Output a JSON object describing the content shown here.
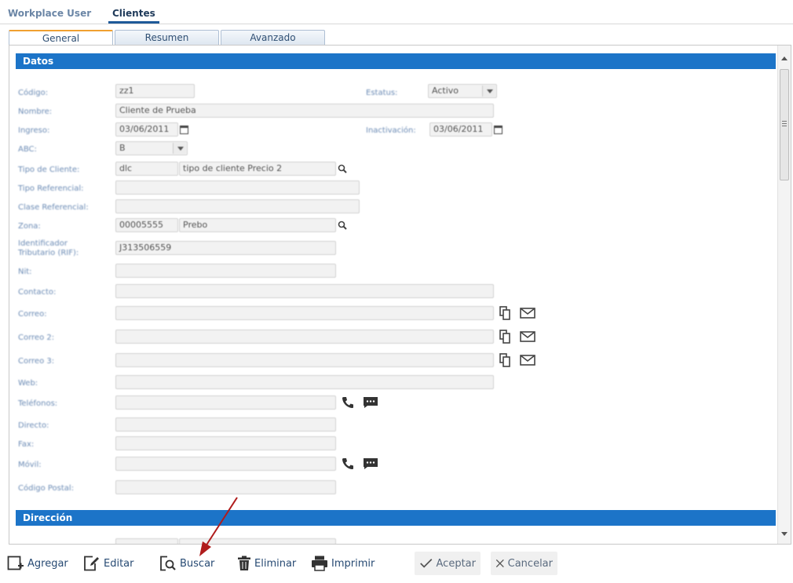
{
  "app_tabs": [
    "Workplace User",
    "Clientes"
  ],
  "subtabs": [
    "General",
    "Resumen",
    "Avanzado"
  ],
  "sections": {
    "datos": "Datos",
    "direccion": "Dirección"
  },
  "labels": {
    "codigo": "Código:",
    "nombre": "Nombre:",
    "ingreso": "Ingreso:",
    "abc": "ABC:",
    "tipo_cliente": "Tipo de Cliente:",
    "tipo_referencial": "Tipo Referencial:",
    "clase_referencial": "Clase Referencial:",
    "zona": "Zona:",
    "identificador_1": "Identificador",
    "identificador_2": "Tributario (RIF):",
    "nit": "Nit:",
    "contacto": "Contacto:",
    "correo": "Correo:",
    "correo2": "Correo 2:",
    "correo3": "Correo 3:",
    "web": "Web:",
    "telefonos": "Teléfonos:",
    "directo": "Directo:",
    "fax": "Fax:",
    "movil": "Móvil:",
    "codigo_postal": "Código Postal:",
    "estatus": "Estatus:",
    "inactivacion": "Inactivación:"
  },
  "values": {
    "codigo": "zz1",
    "nombre": "Cliente de Prueba",
    "ingreso": "03/06/2011",
    "abc": "B",
    "tipo_cliente_code": "dlc",
    "tipo_cliente_desc": "tipo de cliente Precio 2",
    "zona_code": "00005555",
    "zona_desc": "Prebo",
    "rif": "J313506559",
    "estatus": "Activo",
    "inactivacion": "03/06/2011"
  },
  "toolbar": {
    "agregar": "Agregar",
    "editar": "Editar",
    "buscar": "Buscar",
    "eliminar": "Eliminar",
    "imprimir": "Imprimir",
    "aceptar": "Aceptar",
    "cancelar": "Cancelar"
  },
  "colors": {
    "section_header": "#1c74c8",
    "accent_tab": "#f0a030",
    "arrow": "#b01c1c"
  },
  "icons": [
    "calendar-icon",
    "search-icon",
    "copy-icon",
    "mail-icon",
    "phone-icon",
    "sms-icon",
    "add-icon",
    "edit-icon",
    "search-doc-icon",
    "trash-icon",
    "printer-icon",
    "check-icon",
    "x-icon"
  ]
}
